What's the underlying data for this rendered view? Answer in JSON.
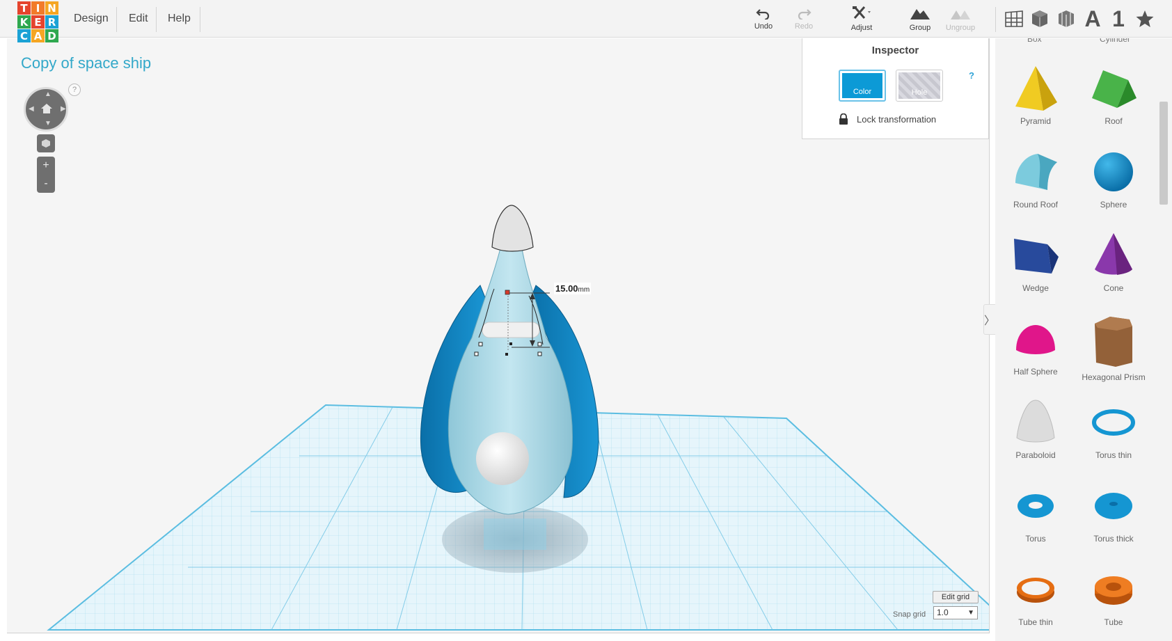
{
  "logo": {
    "letters": [
      "T",
      "I",
      "N",
      "K",
      "E",
      "R",
      "C",
      "A",
      "D"
    ],
    "colors": [
      "#e5442d",
      "#f27b2a",
      "#f5a623",
      "#2fa84f",
      "#e5442d",
      "#1ba2d5",
      "#1ba2d5",
      "#f5a623",
      "#2fa84f"
    ]
  },
  "menu": {
    "design": "Design",
    "edit": "Edit",
    "help": "Help"
  },
  "toolbar": {
    "undo": "Undo",
    "redo": "Redo",
    "adjust": "Adjust",
    "group": "Group",
    "ungroup": "Ungroup"
  },
  "view_tools": {
    "text_icon": "A",
    "number_icon": "1"
  },
  "project": {
    "title": "Copy of space ship"
  },
  "navigation": {
    "help": "?",
    "zoom_in": "+",
    "zoom_out": "-"
  },
  "inspector": {
    "title": "Inspector",
    "help": "?",
    "color_label": "Color",
    "hole_label": "Hole",
    "lock_label": "Lock transformation"
  },
  "dimension": {
    "value": "15.00",
    "unit": "mm"
  },
  "panel": {
    "cut_labels": [
      "Box",
      "Cylinder"
    ],
    "shapes": [
      {
        "label": "Pyramid",
        "color": "#e8c319"
      },
      {
        "label": "Roof",
        "color": "#3da53d"
      },
      {
        "label": "Round Roof",
        "color": "#6ec3d6"
      },
      {
        "label": "Sphere",
        "color": "#1596d2"
      },
      {
        "label": "Wedge",
        "color": "#1f3c8a"
      },
      {
        "label": "Cone",
        "color": "#7a2d9a"
      },
      {
        "label": "Half Sphere",
        "color": "#d4117f"
      },
      {
        "label": "Hexagonal Prism",
        "color": "#8a5a33"
      },
      {
        "label": "Paraboloid",
        "color": "#d8d8d8"
      },
      {
        "label": "Torus thin",
        "color": "#1596d2"
      },
      {
        "label": "Torus",
        "color": "#1596d2"
      },
      {
        "label": "Torus thick",
        "color": "#1596d2"
      },
      {
        "label": "Tube thin",
        "color": "#e56d12"
      },
      {
        "label": "Tube",
        "color": "#e56d12"
      }
    ],
    "toggle": "〉"
  },
  "grid": {
    "edit_label": "Edit grid",
    "snap_label": "Snap grid",
    "snap_value": "1.0"
  }
}
